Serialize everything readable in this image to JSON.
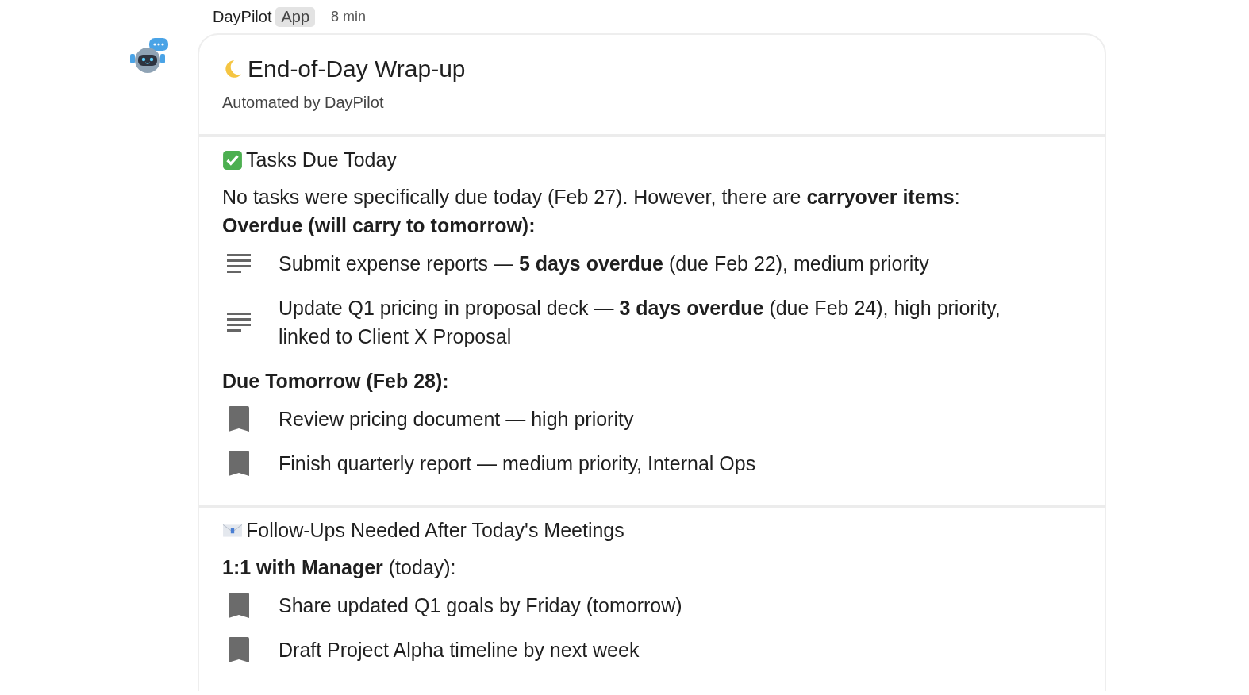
{
  "message": {
    "sender": "DayPilot",
    "badge": "App",
    "time": "8 min"
  },
  "card": {
    "title": "End-of-Day Wrap-up",
    "subtitle": "Automated by DayPilot",
    "sections": [
      {
        "heading": "Tasks Due Today",
        "blocks": [
          {
            "kind": "paragraph",
            "text": "No tasks were specifically due today (Feb 27). However, there are **carryover items**:"
          },
          {
            "kind": "label",
            "text": "**Overdue (will carry to tomorrow):**"
          },
          {
            "kind": "note",
            "text": "Submit expense reports — **5 days overdue** (due Feb 22), medium priority"
          },
          {
            "kind": "note",
            "text": "Update Q1 pricing in proposal deck — **3 days overdue** (due Feb 24), high priority, linked to Client X Proposal"
          },
          {
            "kind": "label",
            "text": "**Due Tomorrow (Feb 28):**"
          },
          {
            "kind": "task",
            "text": "Review pricing document — high priority"
          },
          {
            "kind": "task",
            "text": "Finish quarterly report — medium priority, Internal Ops"
          }
        ]
      },
      {
        "heading": "Follow-Ups Needed After Today's Meetings",
        "blocks": [
          {
            "kind": "label",
            "text": "**1:1 with Manager** (today):"
          },
          {
            "kind": "task",
            "text": "Share updated Q1 goals by Friday (tomorrow)"
          },
          {
            "kind": "task",
            "text": "Draft Project Alpha timeline by next week"
          }
        ]
      }
    ]
  }
}
